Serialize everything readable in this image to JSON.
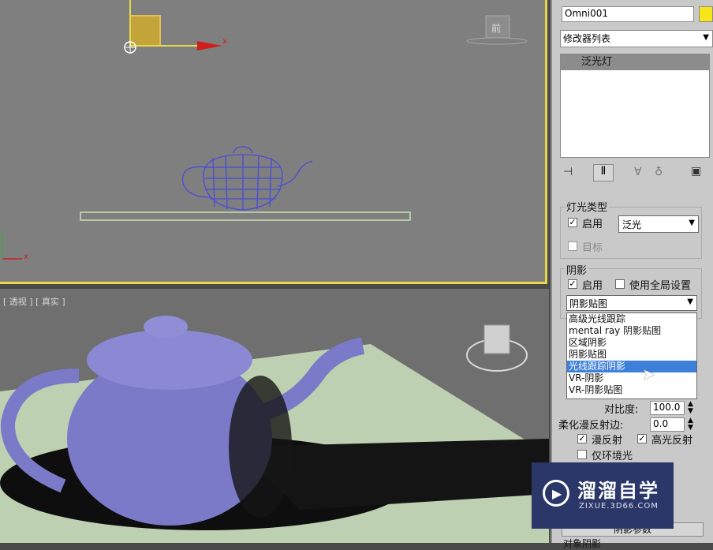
{
  "viewport_top": {
    "axis_x_label": "x",
    "viewcube_label": "前"
  },
  "viewport_bottom": {
    "label": "[ 透视 ] [ 真实 ]"
  },
  "panel": {
    "object_name": "Omni001",
    "object_color": "#f7e51a",
    "modifier_list": "修改器列表",
    "stack_item": "泛光灯"
  },
  "light_type": {
    "title": "灯光类型",
    "enable_label": "启用",
    "type_value": "泛光",
    "target_label": "目标"
  },
  "shadows": {
    "title": "阴影",
    "enable_label": "启用",
    "global_label": "使用全局设置",
    "selected_type": "阴影贴图",
    "options": [
      "高级光线跟踪",
      "mental ray 阴影贴图",
      "区域阴影",
      "阴影贴图",
      "光线跟踪阴影",
      "VR-阴影",
      "VR-阴影贴图"
    ]
  },
  "advanced": {
    "contrast_label": "对比度:",
    "contrast_value": "100.0",
    "soften_label": "柔化漫反射边:",
    "soften_value": "0.0",
    "diffuse_label": "漫反射",
    "specular_label": "高光反射",
    "ambient_label": "仅环境光"
  },
  "footer": {
    "shadow_params": "阴影参数",
    "object_shadow": "对象阴影"
  },
  "watermark": {
    "title": "溜溜自学",
    "url": "ZIXUE.3D66.COM"
  }
}
